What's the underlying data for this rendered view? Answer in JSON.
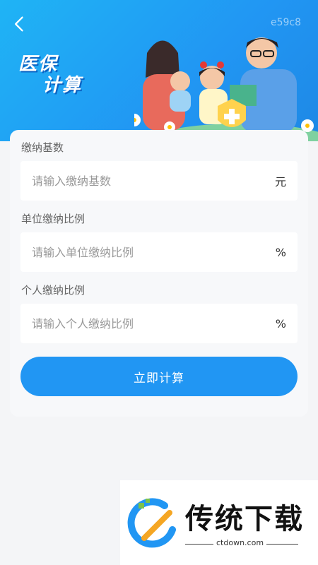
{
  "header": {
    "code": "e59c8",
    "title_line1": "医保",
    "title_line2": "计算"
  },
  "form": {
    "base": {
      "label": "缴纳基数",
      "placeholder": "请输入缴纳基数",
      "unit": "元"
    },
    "company": {
      "label": "单位缴纳比例",
      "placeholder": "请输入单位缴纳比例",
      "unit": "%"
    },
    "personal": {
      "label": "个人缴纳比例",
      "placeholder": "请输入个人缴纳比例",
      "unit": "%"
    },
    "submit_label": "立即计算"
  },
  "watermark": {
    "brand": "传统下载",
    "url": "ctdown.com"
  },
  "colors": {
    "primary": "#2196f3",
    "header_gradient_start": "#1fb4f5"
  }
}
